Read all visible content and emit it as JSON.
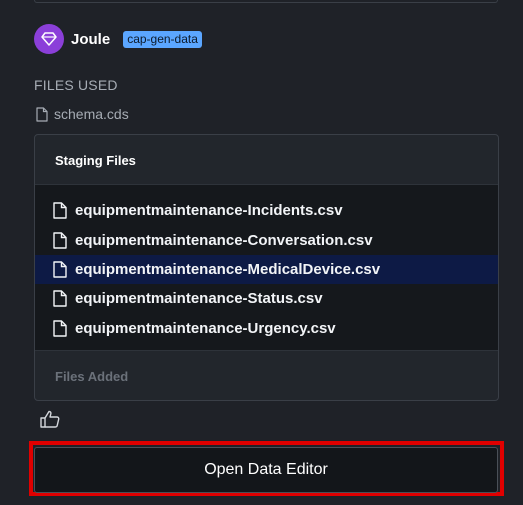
{
  "header": {
    "app_name": "Joule",
    "badge": "cap-gen-data"
  },
  "files_used": {
    "heading": "FILES USED",
    "items": [
      "schema.cds"
    ]
  },
  "staging": {
    "title": "Staging Files",
    "files": [
      "equipmentmaintenance-Incidents.csv",
      "equipmentmaintenance-Conversation.csv",
      "equipmentmaintenance-MedicalDevice.csv",
      "equipmentmaintenance-Status.csv",
      "equipmentmaintenance-Urgency.csv"
    ],
    "selected_index": 2,
    "footer": "Files Added"
  },
  "actions": {
    "open_editor_label": "Open Data Editor"
  },
  "colors": {
    "accent_purple": "#8b3fd9",
    "badge_blue": "#5ba6ff",
    "highlight_red": "#e00000",
    "selected_row": "#0d1a45"
  },
  "icons": {
    "avatar": "joule-diamond-icon",
    "file": "document-icon",
    "feedback": "thumbs-up-icon"
  }
}
